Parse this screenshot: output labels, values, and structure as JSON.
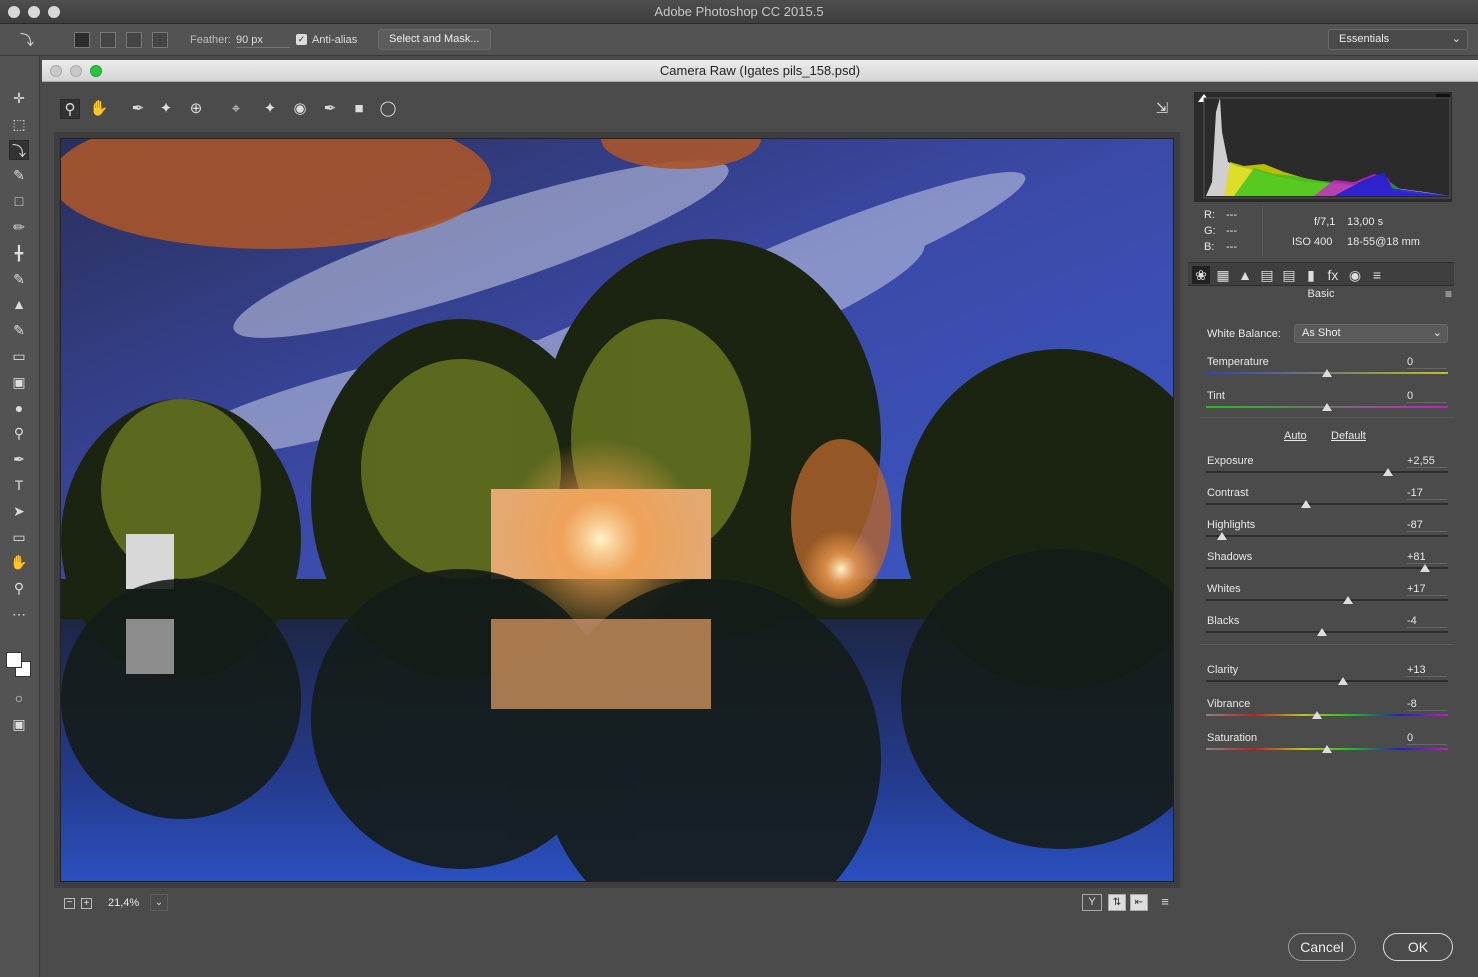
{
  "app": {
    "title": "Adobe Photoshop CC 2015.5"
  },
  "options_bar": {
    "feather_label": "Feather:",
    "feather_value": "90 px",
    "antialias_label": "Anti-alias",
    "antialias_checked": true,
    "select_mask_label": "Select and Mask...",
    "workspace": "Essentials"
  },
  "camera_raw": {
    "title": "Camera Raw (Igates pils_158.psd)",
    "zoom": "21,4%",
    "cancel_label": "Cancel",
    "ok_label": "OK"
  },
  "info": {
    "r_label": "R:",
    "r_value": "---",
    "g_label": "G:",
    "g_value": "---",
    "b_label": "B:",
    "b_value": "---",
    "aperture": "f/7,1",
    "shutter": "13,00 s",
    "iso": "ISO 400",
    "lens": "18-55@18 mm"
  },
  "basic": {
    "title": "Basic",
    "white_balance_label": "White Balance:",
    "white_balance_value": "As Shot",
    "auto_label": "Auto",
    "default_label": "Default",
    "sliders": [
      {
        "label": "Temperature",
        "value": "0",
        "pos": 0.5
      },
      {
        "label": "Tint",
        "value": "0",
        "pos": 0.5
      },
      {
        "label": "Exposure",
        "value": "+2,55",
        "pos": 0.75
      },
      {
        "label": "Contrast",
        "value": "-17",
        "pos": 0.415
      },
      {
        "label": "Highlights",
        "value": "-87",
        "pos": 0.065
      },
      {
        "label": "Shadows",
        "value": "+81",
        "pos": 0.905
      },
      {
        "label": "Whites",
        "value": "+17",
        "pos": 0.585
      },
      {
        "label": "Blacks",
        "value": "-4",
        "pos": 0.48
      },
      {
        "label": "Clarity",
        "value": "+13",
        "pos": 0.565
      },
      {
        "label": "Vibrance",
        "value": "-8",
        "pos": 0.46
      },
      {
        "label": "Saturation",
        "value": "0",
        "pos": 0.5
      }
    ]
  },
  "icons": {
    "left_toolbar": [
      "move-icon",
      "marquee-icon",
      "lasso-icon",
      "quick-select-icon",
      "crop-icon",
      "eyedropper-icon",
      "healing-icon",
      "brush-icon",
      "stamp-icon",
      "history-brush-icon",
      "eraser-icon",
      "gradient-icon",
      "blur-icon",
      "dodge-icon",
      "pen-icon",
      "type-icon",
      "path-select-icon",
      "rectangle-icon",
      "hand-icon",
      "zoom-icon",
      "more-icon"
    ],
    "cr_toolbar": [
      "zoom-icon",
      "hand-icon",
      "white-balance-icon",
      "color-sampler-icon",
      "targeted-adjust-icon",
      "crop-icon",
      "spot-removal-icon",
      "red-eye-icon",
      "adjustment-brush-icon",
      "graduated-filter-icon",
      "radial-filter-icon"
    ],
    "panel_tabs": [
      "basic-tab-icon",
      "tone-curve-tab-icon",
      "detail-tab-icon",
      "hsl-tab-icon",
      "split-toning-tab-icon",
      "lens-tab-icon",
      "effects-tab-icon",
      "camera-calibration-tab-icon",
      "presets-tab-icon"
    ]
  }
}
